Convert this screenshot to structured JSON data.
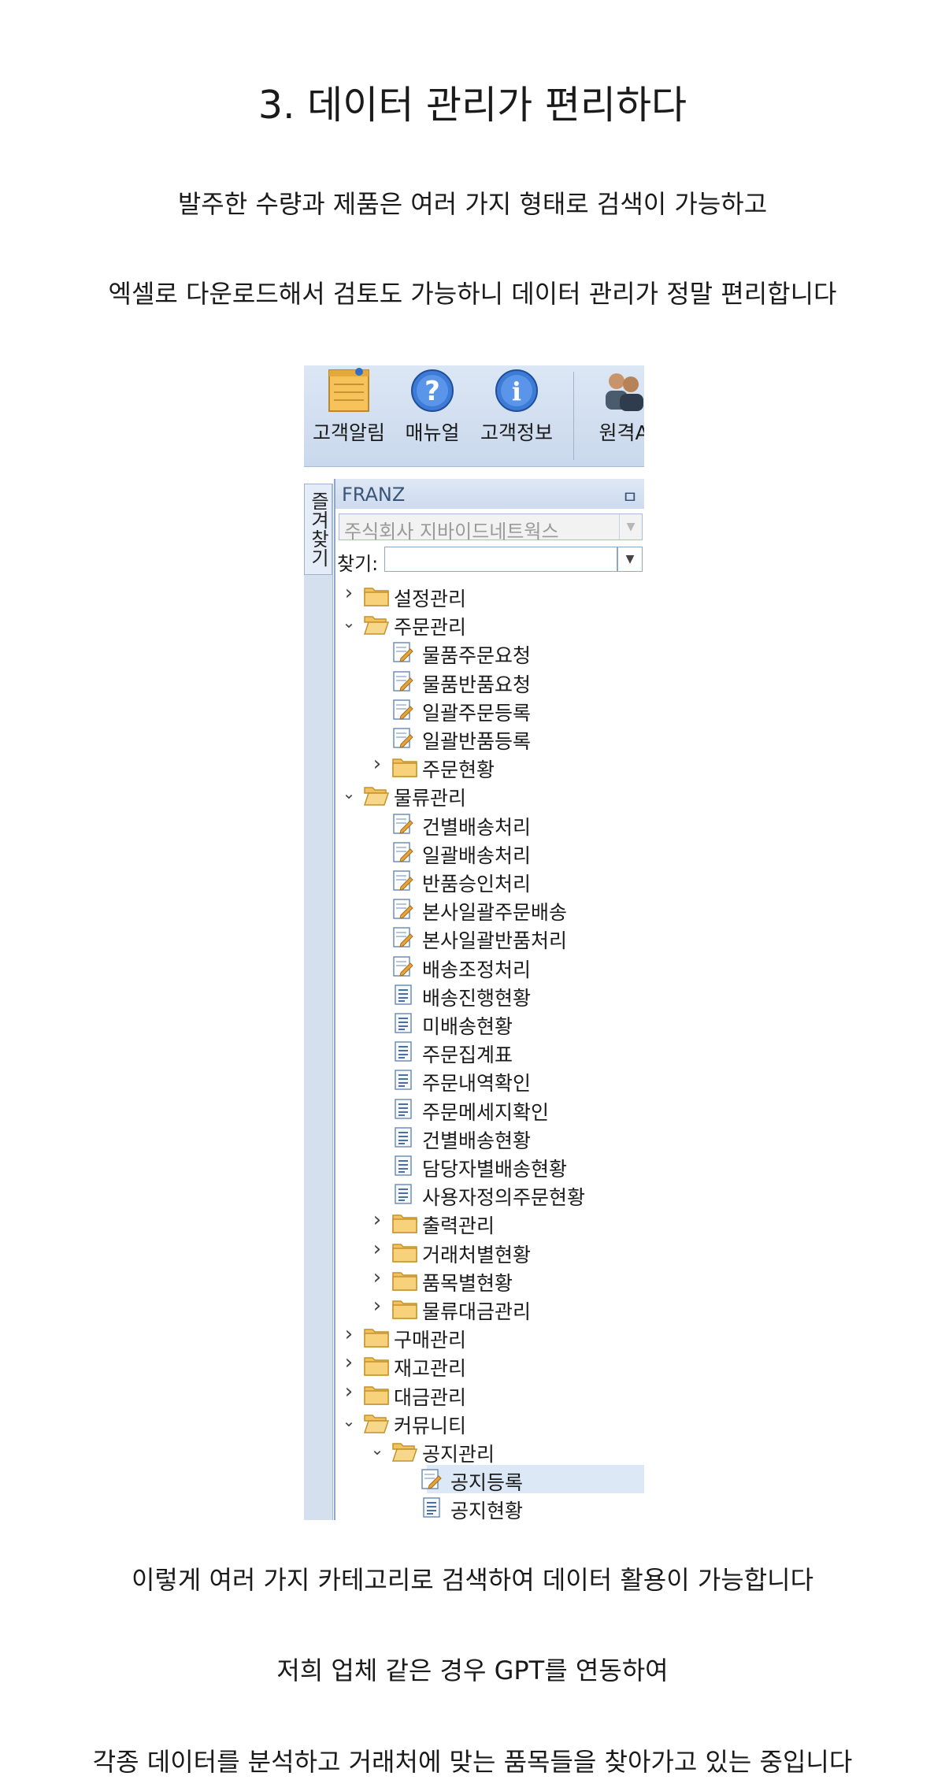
{
  "title": "3. 데이터 관리가 편리하다",
  "paragraphs": {
    "p1": "발주한 수량과 제품은 여러 가지 형태로 검색이 가능하고",
    "p2": "엑셀로 다운로드해서 검토도 가능하니 데이터 관리가 정말 편리합니다",
    "p3": "이렇게 여러 가지 카테고리로 검색하여 데이터 활용이 가능합니다",
    "p4": "저희 업체 같은 경우 GPT를 연동하여",
    "p5": "각종 데이터를 분석하고 거래처에 맞는 품목들을 찾아가고 있는 중입니다"
  },
  "screenshot": {
    "toolbar": [
      {
        "label": "고객알림",
        "icon": "notepad-icon"
      },
      {
        "label": "매뉴얼",
        "icon": "help-icon"
      },
      {
        "label": "고객정보",
        "icon": "info-icon"
      },
      {
        "label": "원격A",
        "icon": "users-icon"
      }
    ],
    "side_tab": "즐겨찾기",
    "panel": {
      "name": "FRANZ",
      "pin": "ㅁ",
      "company": "주식회사 지바이드네트웍스",
      "find_label": "찾기:"
    },
    "tree": [
      {
        "label": "설정관리",
        "level": 0,
        "type": "folder",
        "expanded": false
      },
      {
        "label": "주문관리",
        "level": 0,
        "type": "folder",
        "expanded": true
      },
      {
        "label": "물품주문요청",
        "level": 1,
        "type": "form"
      },
      {
        "label": "물품반품요청",
        "level": 1,
        "type": "form"
      },
      {
        "label": "일괄주문등록",
        "level": 1,
        "type": "form"
      },
      {
        "label": "일괄반품등록",
        "level": 1,
        "type": "form"
      },
      {
        "label": "주문현황",
        "level": 1,
        "type": "folder",
        "expanded": false
      },
      {
        "label": "물류관리",
        "level": 0,
        "type": "folder",
        "expanded": true
      },
      {
        "label": "건별배송처리",
        "level": 1,
        "type": "form"
      },
      {
        "label": "일괄배송처리",
        "level": 1,
        "type": "form"
      },
      {
        "label": "반품승인처리",
        "level": 1,
        "type": "form"
      },
      {
        "label": "본사일괄주문배송",
        "level": 1,
        "type": "form"
      },
      {
        "label": "본사일괄반품처리",
        "level": 1,
        "type": "form"
      },
      {
        "label": "배송조정처리",
        "level": 1,
        "type": "form"
      },
      {
        "label": "배송진행현황",
        "level": 1,
        "type": "report"
      },
      {
        "label": "미배송현황",
        "level": 1,
        "type": "report"
      },
      {
        "label": "주문집계표",
        "level": 1,
        "type": "report"
      },
      {
        "label": "주문내역확인",
        "level": 1,
        "type": "report"
      },
      {
        "label": "주문메세지확인",
        "level": 1,
        "type": "report"
      },
      {
        "label": "건별배송현황",
        "level": 1,
        "type": "report"
      },
      {
        "label": "담당자별배송현황",
        "level": 1,
        "type": "report"
      },
      {
        "label": "사용자정의주문현황",
        "level": 1,
        "type": "report"
      },
      {
        "label": "출력관리",
        "level": 1,
        "type": "folder",
        "expanded": false
      },
      {
        "label": "거래처별현황",
        "level": 1,
        "type": "folder",
        "expanded": false
      },
      {
        "label": "품목별현황",
        "level": 1,
        "type": "folder",
        "expanded": false
      },
      {
        "label": "물류대금관리",
        "level": 1,
        "type": "folder",
        "expanded": false
      },
      {
        "label": "구매관리",
        "level": 0,
        "type": "folder",
        "expanded": false
      },
      {
        "label": "재고관리",
        "level": 0,
        "type": "folder",
        "expanded": false
      },
      {
        "label": "대금관리",
        "level": 0,
        "type": "folder",
        "expanded": false
      },
      {
        "label": "커뮤니티",
        "level": 0,
        "type": "folder",
        "expanded": true
      },
      {
        "label": "공지관리",
        "level": 1,
        "type": "folder",
        "expanded": true
      },
      {
        "label": "공지등록",
        "level": 2,
        "type": "form",
        "selected": true
      },
      {
        "label": "공지현황",
        "level": 2,
        "type": "report"
      }
    ]
  }
}
